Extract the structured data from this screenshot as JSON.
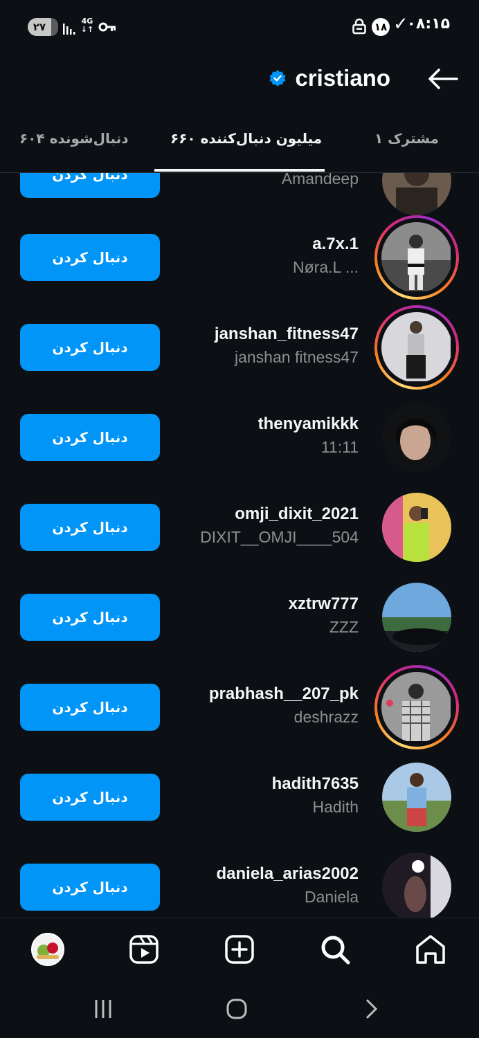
{
  "status_bar": {
    "time": "۰۸:۱۵",
    "check_mark": "✓",
    "notification_count": "۱۸",
    "battery": "۲۷",
    "network": "4G"
  },
  "header": {
    "title": "cristiano",
    "verified": true
  },
  "tabs": [
    {
      "label": "۱ مشترک",
      "active": false
    },
    {
      "label": "۶۶۰ میلیون دنبال‌کننده",
      "active": true
    },
    {
      "label": "۶۰۴ دنبال‌شونده",
      "active": false
    }
  ],
  "follow_label": "دنبال کردن",
  "partial_row": {
    "fullname": "Amandeep"
  },
  "rows": [
    {
      "username": "a.7x.1",
      "fullname": "Nøra.L ...",
      "story_ring": true
    },
    {
      "username": "janshan_fitness47",
      "fullname": "janshan  fitness47",
      "story_ring": true
    },
    {
      "username": "thenyamikkk",
      "fullname": "11:11",
      "story_ring": false
    },
    {
      "username": "omji_dixit_2021",
      "fullname": "DIXIT__OMJI____504",
      "story_ring": false
    },
    {
      "username": "xztrw777",
      "fullname": "ZZZ",
      "story_ring": false
    },
    {
      "username": "prabhash__207_pk",
      "fullname": "deshrazz",
      "story_ring": true
    },
    {
      "username": "hadith7635",
      "fullname": "Hadith",
      "story_ring": false
    },
    {
      "username": "daniela_arias2002",
      "fullname": "Daniela",
      "story_ring": false
    }
  ],
  "bottom_nav": [
    "profile-avatar",
    "reels-icon",
    "create-icon",
    "search-icon",
    "home-icon"
  ],
  "colors": {
    "background": "#0c1014",
    "accent": "#0095f6",
    "verified": "#0095f6"
  }
}
